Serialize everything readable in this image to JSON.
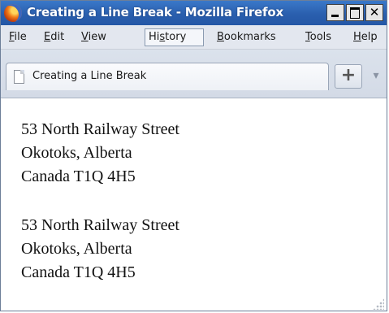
{
  "window": {
    "title": "Creating a Line Break - Mozilla Firefox",
    "buttons": {
      "minimize_icon": "minimize-icon",
      "maximize_icon": "maximize-icon",
      "close_label": "✕"
    }
  },
  "menu": {
    "items": [
      {
        "label": "File",
        "underline": "F"
      },
      {
        "label": "Edit",
        "underline": "E"
      },
      {
        "label": "View",
        "underline": "V"
      },
      {
        "label": "History",
        "underline": "s"
      },
      {
        "label": "Bookmarks",
        "underline": "B"
      },
      {
        "label": "Tools",
        "underline": "T"
      },
      {
        "label": "Help",
        "underline": "H"
      }
    ],
    "active": "History"
  },
  "tabs": {
    "current": {
      "label": "Creating a Line Break",
      "icon": "page-icon"
    },
    "new_tab_label": "+",
    "list_all_label": "▾"
  },
  "content": {
    "paragraphs": [
      {
        "lines": [
          "53 North Railway Street",
          "Okotoks, Alberta",
          "Canada T1Q 4H5"
        ]
      },
      {
        "lines": [
          "53 North Railway Street",
          "Okotoks, Alberta",
          "Canada T1Q 4H5"
        ]
      }
    ]
  }
}
